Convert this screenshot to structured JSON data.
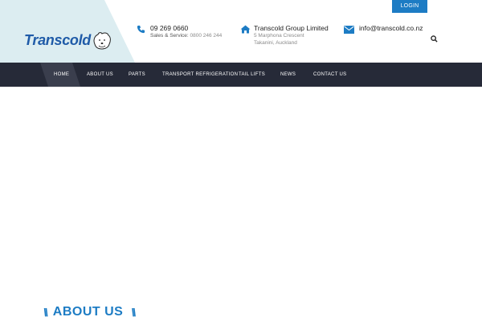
{
  "top_bar": {
    "login_label": "LOGIN"
  },
  "logo": {
    "text": "Transcold"
  },
  "contacts": {
    "phone": {
      "main": "09 269 0660",
      "sub_label": "Sales & Service:",
      "sub_value": "0800 246 244"
    },
    "address": {
      "main": "Transcold Group Limited",
      "line1": "5 Marphona Crescent",
      "line2": "Takanini, Auckland"
    },
    "email": {
      "main": "info@transcold.co.nz"
    }
  },
  "nav": {
    "items": [
      {
        "label": "HOME"
      },
      {
        "label": "ABOUT US"
      },
      {
        "label": "PARTS"
      },
      {
        "label": "TRANSPORT REFRIGERATION"
      },
      {
        "label": "TAIL LIFTS"
      },
      {
        "label": "NEWS"
      },
      {
        "label": "CONTACT US"
      }
    ]
  },
  "section": {
    "heading": "ABOUT US",
    "slash_left": "\\\\",
    "slash_right": "\\\\"
  },
  "colors": {
    "accent": "#1d7cc4",
    "nav_bg": "#262a38",
    "logo_panel": "#dcedf1",
    "logo_blue": "#1f5ba8"
  },
  "icons": {
    "phone": "phone-icon",
    "address": "home-icon",
    "email": "envelope-icon",
    "search": "search-icon"
  }
}
